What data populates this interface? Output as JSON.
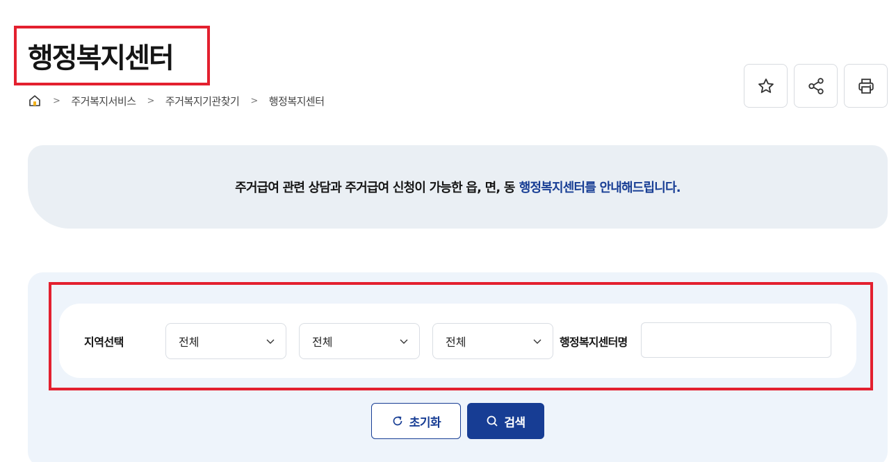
{
  "page": {
    "title": "행정복지센터"
  },
  "breadcrumb": {
    "home_icon": "home-icon",
    "items": [
      "주거복지서비스",
      "주거복지기관찾기",
      "행정복지센터"
    ]
  },
  "toolbar": {
    "favorite_icon": "star-icon",
    "share_icon": "share-icon",
    "print_icon": "printer-icon"
  },
  "notice": {
    "text": "주거급여 관련 상담과 주거급여 신청이 가능한 읍, 면, 동",
    "highlight": "행정복지센터를 안내해드립니다."
  },
  "filter": {
    "region_label": "지역선택",
    "selects": [
      {
        "value": "전체"
      },
      {
        "value": "전체"
      },
      {
        "value": "전체"
      }
    ],
    "name_label": "행정복지센터명",
    "name_value": "",
    "name_placeholder": ""
  },
  "actions": {
    "reset_label": "초기화",
    "search_label": "검색"
  },
  "colors": {
    "accent": "#173d94",
    "highlight_frame": "#e3202f",
    "notice_bg": "#eaeff4",
    "panel_bg": "#eef4fb"
  }
}
